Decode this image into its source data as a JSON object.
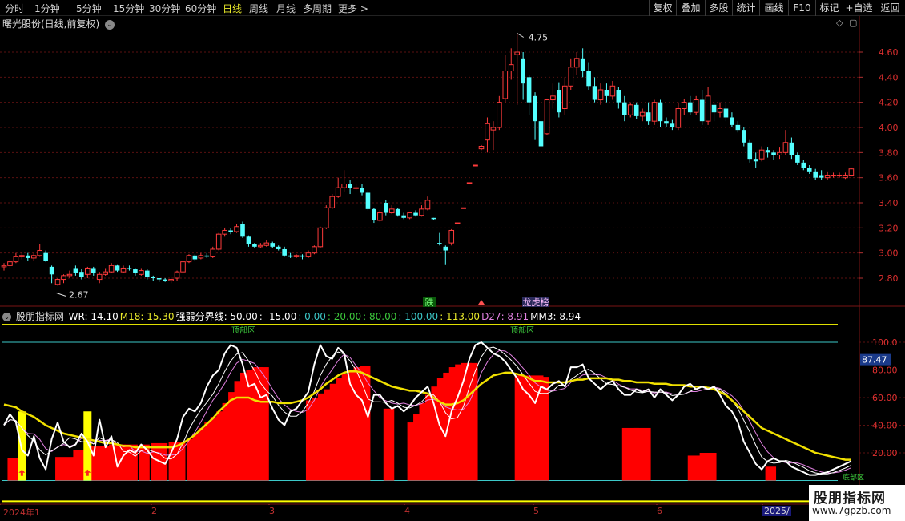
{
  "toolbar": {
    "periods": [
      "分时",
      "1分钟",
      "5分钟",
      "15分钟",
      "30分钟",
      "60分钟",
      "日线",
      "周线",
      "月线",
      "多周期",
      "更多 >"
    ],
    "active_period": "日线",
    "right_buttons": [
      "复权",
      "叠加",
      "多股",
      "统计",
      "画线",
      "F10",
      "标记",
      "+自选",
      "返回"
    ]
  },
  "stock": {
    "title": "曙光股份(日线,前复权)"
  },
  "price_axis": {
    "labels": [
      "4.60",
      "4.40",
      "4.20",
      "4.00",
      "3.80",
      "3.60",
      "3.40",
      "3.20",
      "3.00",
      "2.80"
    ]
  },
  "price_annotations": {
    "high": "4.75",
    "low": "2.67"
  },
  "markers": {
    "die": "跌",
    "longhu": "龙虎榜"
  },
  "indicator": {
    "name": "股朋指标网",
    "values": [
      {
        "text": "WR: 14.10",
        "color": "#ffffff"
      },
      {
        "text": "M18: 15.30",
        "color": "#e8e82a"
      },
      {
        "text": "强弱分界线: 50.00",
        "color": "#ffffff"
      },
      {
        "text": ": -15.00",
        "color": "#ffffff"
      },
      {
        "text": ": 0.00",
        "color": "#3cc8c8"
      },
      {
        "text": ": 20.00",
        "color": "#3cc83c"
      },
      {
        "text": ": 80.00",
        "color": "#3cc83c"
      },
      {
        "text": ": 100.00",
        "color": "#3cc8c8"
      },
      {
        "text": ": 113.00",
        "color": "#e8e82a"
      },
      {
        "text": "D27: 8.91",
        "color": "#e080e0"
      },
      {
        "text": "MM3: 8.94",
        "color": "#ffffff"
      }
    ],
    "top_zone_label": "顶部区",
    "bottom_zone_label": "底部区",
    "axis_labels": [
      "100.0",
      "80.00",
      "60.00",
      "40.00",
      "20.00"
    ],
    "current_value": "87.47"
  },
  "time_axis": {
    "labels": [
      "2024年1",
      "2",
      "3",
      "4",
      "5",
      "6",
      "2025/"
    ]
  },
  "watermark": {
    "name": "股朋指标网",
    "url": "www.7gpzb.com"
  },
  "colors": {
    "up": "#ff3b3b",
    "down": "#54ffff",
    "wr_line": "#ffffff",
    "m18_line": "#f0e000",
    "bar": "#ff0000",
    "signal": "#ffff00"
  },
  "candles": [
    [
      2.89,
      2.9,
      2.86,
      2.92
    ],
    [
      2.9,
      2.93,
      2.88,
      2.95
    ],
    [
      2.93,
      2.97,
      2.92,
      3.0
    ],
    [
      2.97,
      2.98,
      2.95,
      3.01
    ],
    [
      2.98,
      2.96,
      2.94,
      3.0
    ],
    [
      2.96,
      2.98,
      2.94,
      3.0
    ],
    [
      2.98,
      3.02,
      2.97,
      3.07
    ],
    [
      3.0,
      2.94,
      2.93,
      3.02
    ],
    [
      2.89,
      2.83,
      2.76,
      2.9
    ],
    [
      2.75,
      2.79,
      2.74,
      2.8
    ],
    [
      2.79,
      2.82,
      2.76,
      2.83
    ],
    [
      2.82,
      2.83,
      2.8,
      2.86
    ],
    [
      2.88,
      2.84,
      2.82,
      2.9
    ],
    [
      2.85,
      2.81,
      2.79,
      2.87
    ],
    [
      2.83,
      2.88,
      2.8,
      2.89
    ],
    [
      2.88,
      2.84,
      2.82,
      2.89
    ],
    [
      2.79,
      2.83,
      2.76,
      2.85
    ],
    [
      2.83,
      2.85,
      2.82,
      2.88
    ],
    [
      2.85,
      2.9,
      2.84,
      2.92
    ],
    [
      2.9,
      2.86,
      2.85,
      2.91
    ],
    [
      2.85,
      2.88,
      2.84,
      2.9
    ],
    [
      2.88,
      2.87,
      2.86,
      2.9
    ],
    [
      2.87,
      2.84,
      2.82,
      2.88
    ],
    [
      2.83,
      2.86,
      2.82,
      2.88
    ],
    [
      2.86,
      2.81,
      2.79,
      2.87
    ],
    [
      2.81,
      2.8,
      2.78,
      2.82
    ],
    [
      2.8,
      2.79,
      2.77,
      2.8
    ],
    [
      2.79,
      2.78,
      2.77,
      2.8
    ],
    [
      2.78,
      2.79,
      2.76,
      2.81
    ],
    [
      2.8,
      2.85,
      2.78,
      2.86
    ],
    [
      2.85,
      2.93,
      2.84,
      2.95
    ],
    [
      2.93,
      2.98,
      2.92,
      2.99
    ],
    [
      2.98,
      2.95,
      2.94,
      2.99
    ],
    [
      2.96,
      2.98,
      2.95,
      3.0
    ],
    [
      2.98,
      2.97,
      2.96,
      3.0
    ],
    [
      2.97,
      3.03,
      2.96,
      3.05
    ],
    [
      3.03,
      3.15,
      3.02,
      3.16
    ],
    [
      3.15,
      3.18,
      3.13,
      3.2
    ],
    [
      3.18,
      3.17,
      3.15,
      3.2
    ],
    [
      3.17,
      3.21,
      3.16,
      3.23
    ],
    [
      3.23,
      3.13,
      3.12,
      3.25
    ],
    [
      3.13,
      3.07,
      3.05,
      3.14
    ],
    [
      3.07,
      3.05,
      3.04,
      3.08
    ],
    [
      3.05,
      3.06,
      3.04,
      3.08
    ],
    [
      3.06,
      3.08,
      3.05,
      3.1
    ],
    [
      3.08,
      3.05,
      3.04,
      3.09
    ],
    [
      3.05,
      3.03,
      3.02,
      3.06
    ],
    [
      3.03,
      2.98,
      2.97,
      3.05
    ],
    [
      2.98,
      2.97,
      2.96,
      3.0
    ],
    [
      2.97,
      2.98,
      2.96,
      2.99
    ],
    [
      2.98,
      2.97,
      2.95,
      2.99
    ],
    [
      2.97,
      3.0,
      2.96,
      3.02
    ],
    [
      3.0,
      3.05,
      2.99,
      3.06
    ],
    [
      3.05,
      3.2,
      3.04,
      3.21
    ],
    [
      3.2,
      3.36,
      3.19,
      3.38
    ],
    [
      3.36,
      3.45,
      3.35,
      3.47
    ],
    [
      3.45,
      3.52,
      3.44,
      3.6
    ],
    [
      3.52,
      3.55,
      3.49,
      3.66
    ],
    [
      3.55,
      3.52,
      3.47,
      3.58
    ],
    [
      3.52,
      3.52,
      3.5,
      3.55
    ],
    [
      3.52,
      3.48,
      3.46,
      3.55
    ],
    [
      3.48,
      3.35,
      3.34,
      3.5
    ],
    [
      3.35,
      3.26,
      3.24,
      3.36
    ],
    [
      3.26,
      3.32,
      3.25,
      3.34
    ],
    [
      3.4,
      3.32,
      3.3,
      3.42
    ],
    [
      3.32,
      3.35,
      3.31,
      3.38
    ],
    [
      3.35,
      3.3,
      3.29,
      3.36
    ],
    [
      3.3,
      3.28,
      3.27,
      3.32
    ],
    [
      3.28,
      3.32,
      3.27,
      3.33
    ],
    [
      3.32,
      3.3,
      3.29,
      3.34
    ],
    [
      3.3,
      3.35,
      3.29,
      3.38
    ],
    [
      3.35,
      3.42,
      3.34,
      3.45
    ],
    [
      3.28,
      3.27,
      3.26,
      3.28
    ],
    [
      3.08,
      3.07,
      3.06,
      3.16
    ],
    [
      3.05,
      3.02,
      2.91,
      3.06
    ],
    [
      3.08,
      3.18,
      3.06,
      3.19
    ],
    [
      3.24,
      3.24,
      3.24,
      3.24
    ],
    [
      3.36,
      3.36,
      3.36,
      3.36
    ],
    [
      3.56,
      3.56,
      3.56,
      3.56
    ],
    [
      3.7,
      3.7,
      3.7,
      3.7
    ],
    [
      3.83,
      3.85,
      3.82,
      3.86
    ],
    [
      3.9,
      4.03,
      3.8,
      4.08
    ],
    [
      3.98,
      4.0,
      3.82,
      4.05
    ],
    [
      4.0,
      4.2,
      3.98,
      4.25
    ],
    [
      4.23,
      4.45,
      4.2,
      4.58
    ],
    [
      4.45,
      4.5,
      4.38,
      4.63
    ],
    [
      4.58,
      4.6,
      4.18,
      4.75
    ],
    [
      4.55,
      4.35,
      4.22,
      4.6
    ],
    [
      4.4,
      4.2,
      4.1,
      4.42
    ],
    [
      4.25,
      4.05,
      3.9,
      4.28
    ],
    [
      4.05,
      3.85,
      3.84,
      4.1
    ],
    [
      3.95,
      4.22,
      3.94,
      4.23
    ],
    [
      4.22,
      4.25,
      4.15,
      4.35
    ],
    [
      4.3,
      4.12,
      4.08,
      4.36
    ],
    [
      4.15,
      4.33,
      4.1,
      4.4
    ],
    [
      4.33,
      4.48,
      4.3,
      4.55
    ],
    [
      4.48,
      4.55,
      4.42,
      4.6
    ],
    [
      4.55,
      4.45,
      4.4,
      4.63
    ],
    [
      4.45,
      4.33,
      4.3,
      4.52
    ],
    [
      4.33,
      4.22,
      4.2,
      4.4
    ],
    [
      4.22,
      4.3,
      4.18,
      4.35
    ],
    [
      4.3,
      4.25,
      4.2,
      4.35
    ],
    [
      4.25,
      4.33,
      4.22,
      4.37
    ],
    [
      4.3,
      4.2,
      4.15,
      4.32
    ],
    [
      4.2,
      4.1,
      4.05,
      4.25
    ],
    [
      4.1,
      4.18,
      4.08,
      4.2
    ],
    [
      4.18,
      4.09,
      4.07,
      4.2
    ],
    [
      4.09,
      4.12,
      4.05,
      4.15
    ],
    [
      4.12,
      4.05,
      4.02,
      4.2
    ],
    [
      4.05,
      4.2,
      4.02,
      4.22
    ],
    [
      4.2,
      4.05,
      4.0,
      4.22
    ],
    [
      4.05,
      4.03,
      4.0,
      4.08
    ],
    [
      4.03,
      4.0,
      3.98,
      4.06
    ],
    [
      4.0,
      4.15,
      3.98,
      4.2
    ],
    [
      4.15,
      4.2,
      4.1,
      4.23
    ],
    [
      4.2,
      4.12,
      4.1,
      4.25
    ],
    [
      4.12,
      4.22,
      4.1,
      4.25
    ],
    [
      4.22,
      4.05,
      4.02,
      4.3
    ],
    [
      4.05,
      4.25,
      4.02,
      4.32
    ],
    [
      4.18,
      4.12,
      4.05,
      4.2
    ],
    [
      4.12,
      4.15,
      4.08,
      4.2
    ],
    [
      4.15,
      4.08,
      4.05,
      4.2
    ],
    [
      4.08,
      4.02,
      4.0,
      4.12
    ],
    [
      4.02,
      3.98,
      3.96,
      4.05
    ],
    [
      3.98,
      3.88,
      3.85,
      4.0
    ],
    [
      3.88,
      3.75,
      3.72,
      3.9
    ],
    [
      3.75,
      3.73,
      3.68,
      3.8
    ],
    [
      3.75,
      3.82,
      3.73,
      3.85
    ],
    [
      3.82,
      3.8,
      3.76,
      3.84
    ],
    [
      3.8,
      3.78,
      3.74,
      3.82
    ],
    [
      3.78,
      3.8,
      3.75,
      3.84
    ],
    [
      3.8,
      3.88,
      3.78,
      3.98
    ],
    [
      3.88,
      3.78,
      3.75,
      3.92
    ],
    [
      3.78,
      3.72,
      3.7,
      3.8
    ],
    [
      3.72,
      3.68,
      3.66,
      3.74
    ],
    [
      3.68,
      3.65,
      3.63,
      3.7
    ],
    [
      3.65,
      3.6,
      3.58,
      3.67
    ],
    [
      3.62,
      3.6,
      3.58,
      3.66
    ],
    [
      3.6,
      3.62,
      3.58,
      3.65
    ],
    [
      3.62,
      3.62,
      3.6,
      3.64
    ],
    [
      3.62,
      3.62,
      3.6,
      3.64
    ],
    [
      3.6,
      3.62,
      3.59,
      3.64
    ],
    [
      3.62,
      3.67,
      3.61,
      3.68
    ]
  ],
  "wr_series": [
    40,
    48,
    42,
    22,
    18,
    32,
    16,
    8,
    30,
    42,
    28,
    24,
    26,
    34,
    28,
    18,
    44,
    24,
    32,
    10,
    18,
    22,
    20,
    26,
    22,
    16,
    14,
    12,
    20,
    30,
    46,
    52,
    50,
    56,
    68,
    76,
    80,
    92,
    98,
    96,
    84,
    68,
    70,
    60,
    62,
    52,
    44,
    40,
    50,
    52,
    58,
    64,
    84,
    98,
    90,
    88,
    96,
    92,
    70,
    62,
    58,
    46,
    62,
    62,
    56,
    52,
    54,
    50,
    54,
    60,
    64,
    68,
    56,
    40,
    32,
    50,
    60,
    72,
    88,
    98,
    100,
    96,
    92,
    90,
    86,
    80,
    74,
    66,
    62,
    56,
    68,
    66,
    70,
    72,
    68,
    82,
    82,
    84,
    74,
    70,
    66,
    70,
    72,
    66,
    62,
    62,
    66,
    64,
    66,
    60,
    66,
    62,
    58,
    62,
    68,
    70,
    66,
    68,
    66,
    68,
    62,
    54,
    50,
    42,
    28,
    20,
    12,
    8,
    14,
    16,
    14,
    14,
    10,
    8,
    6,
    4,
    4,
    5,
    6,
    8,
    10,
    12,
    14
  ],
  "m18_series": [
    55,
    54,
    53,
    50,
    48,
    46,
    43,
    40,
    38,
    36,
    34,
    33,
    32,
    31,
    30,
    29,
    28,
    27,
    27,
    26,
    25,
    25,
    24,
    24,
    24,
    24,
    24,
    24,
    24,
    25,
    27,
    30,
    33,
    37,
    41,
    45,
    50,
    54,
    58,
    60,
    60,
    60,
    58,
    57,
    57,
    57,
    56,
    56,
    56,
    57,
    58,
    60,
    63,
    66,
    70,
    73,
    76,
    78,
    79,
    79,
    78,
    76,
    74,
    72,
    70,
    68,
    67,
    66,
    65,
    65,
    64,
    63,
    60,
    57,
    55,
    55,
    56,
    58,
    62,
    66,
    70,
    73,
    76,
    77,
    78,
    78,
    77,
    76,
    74,
    72,
    72,
    71,
    71,
    71,
    71,
    72,
    73,
    73,
    74,
    74,
    74,
    74,
    73,
    73,
    72,
    72,
    71,
    71,
    71,
    70,
    70,
    70,
    69,
    69,
    69,
    68,
    68,
    68,
    67,
    66,
    64,
    62,
    58,
    54,
    50,
    46,
    42,
    38,
    36,
    34,
    32,
    30,
    28,
    26,
    24,
    22,
    20,
    19,
    18,
    17,
    16,
    15,
    15
  ],
  "bars": [
    [
      1,
      2,
      16
    ],
    [
      9,
      12,
      17
    ],
    [
      12,
      14,
      22
    ],
    [
      15,
      18,
      25
    ],
    [
      18,
      20,
      26
    ],
    [
      20,
      22,
      26
    ],
    [
      23,
      24,
      26
    ],
    [
      25,
      27,
      27
    ],
    [
      28,
      30,
      28
    ],
    [
      31,
      32,
      30
    ],
    [
      32,
      33,
      34
    ],
    [
      33,
      34,
      38
    ],
    [
      34,
      35,
      42
    ],
    [
      35,
      36,
      46
    ],
    [
      36,
      37,
      50
    ],
    [
      37,
      38,
      56
    ],
    [
      38,
      39,
      64
    ],
    [
      39,
      40,
      72
    ],
    [
      40,
      41,
      78
    ],
    [
      41,
      42,
      80
    ],
    [
      42,
      43,
      82
    ],
    [
      43,
      44,
      82
    ],
    [
      51,
      52,
      58
    ],
    [
      52,
      53,
      60
    ],
    [
      53,
      54,
      63
    ],
    [
      54,
      55,
      66
    ],
    [
      55,
      56,
      70
    ],
    [
      56,
      57,
      74
    ],
    [
      57,
      58,
      77
    ],
    [
      58,
      59,
      80
    ],
    [
      59,
      60,
      82
    ],
    [
      60,
      61,
      83
    ],
    [
      64,
      65,
      52
    ],
    [
      68,
      69,
      42
    ],
    [
      69,
      70,
      48
    ],
    [
      70,
      71,
      56
    ],
    [
      71,
      72,
      62
    ],
    [
      72,
      73,
      68
    ],
    [
      73,
      74,
      74
    ],
    [
      74,
      75,
      78
    ],
    [
      75,
      76,
      82
    ],
    [
      76,
      77,
      84
    ],
    [
      77,
      78,
      85
    ],
    [
      78,
      79,
      85
    ],
    [
      86,
      90,
      76
    ],
    [
      90,
      91,
      75
    ],
    [
      104,
      106,
      38
    ],
    [
      106,
      108,
      38
    ],
    [
      115,
      117,
      18
    ],
    [
      117,
      119,
      20
    ],
    [
      128,
      129,
      10
    ]
  ],
  "signals": [
    3,
    14
  ]
}
